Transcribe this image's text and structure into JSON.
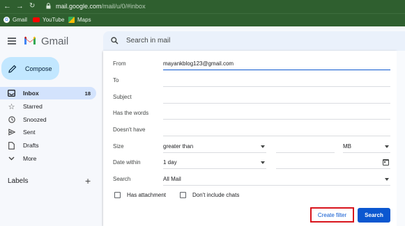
{
  "browser": {
    "url_host": "mail.google.com",
    "url_path": "/mail/u/0/#inbox",
    "bookmarks": [
      {
        "label": "Gmail",
        "icon": "google-icon",
        "color": "#ffffff"
      },
      {
        "label": "YouTube",
        "icon": "youtube-icon",
        "color": "#ff0000"
      },
      {
        "label": "Maps",
        "icon": "maps-icon",
        "color": "#34a853"
      }
    ]
  },
  "app": {
    "name": "Gmail"
  },
  "compose_label": "Compose",
  "nav": [
    {
      "label": "Inbox",
      "count": "18",
      "icon": "inbox-icon"
    },
    {
      "label": "Starred",
      "count": "",
      "icon": "star-icon"
    },
    {
      "label": "Snoozed",
      "count": "",
      "icon": "clock-icon"
    },
    {
      "label": "Sent",
      "count": "",
      "icon": "send-icon"
    },
    {
      "label": "Drafts",
      "count": "",
      "icon": "draft-icon"
    },
    {
      "label": "More",
      "count": "",
      "icon": "chevron-down-icon"
    }
  ],
  "labels_heading": "Labels",
  "search": {
    "placeholder": "Search in mail"
  },
  "filter": {
    "from_label": "From",
    "from_value": "mayankblog123@gmail.com",
    "to_label": "To",
    "subject_label": "Subject",
    "has_words_label": "Has the words",
    "doesnt_have_label": "Doesn't have",
    "size_label": "Size",
    "size_op": "greater than",
    "size_unit": "MB",
    "date_label": "Date within",
    "date_value": "1 day",
    "search_label": "Search",
    "search_value": "All Mail",
    "has_attachment": "Has attachment",
    "no_chats": "Don't include chats",
    "create_filter": "Create filter",
    "search_button": "Search"
  },
  "colors": {
    "accent": "#0b57d0",
    "compose_bg": "#c2e7ff",
    "active_nav": "#d3e3fd",
    "highlight_border": "#d8141c",
    "chrome": "#2f5f2f"
  }
}
